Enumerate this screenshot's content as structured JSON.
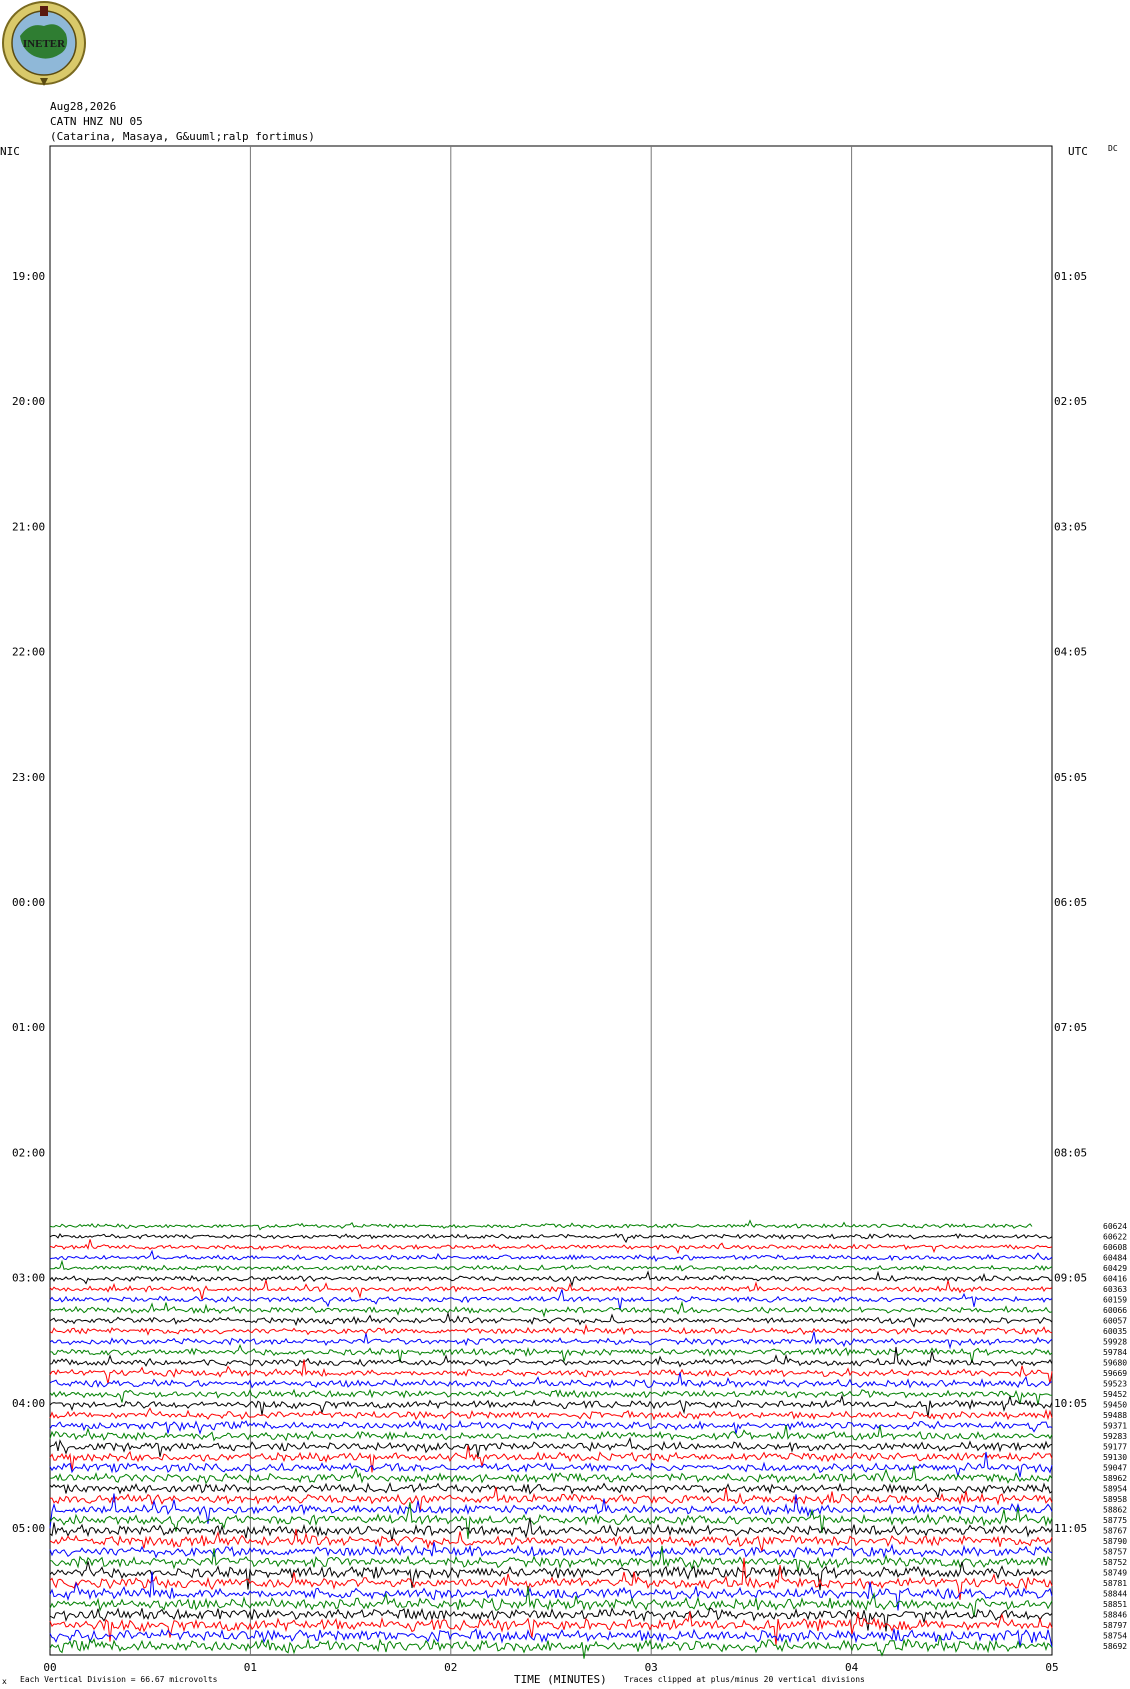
{
  "header": {
    "date": "Aug28,2026",
    "channel": "CATN HNZ NU 05",
    "location": "(Catarina, Masaya, G&uuml;ralp fortimus)",
    "left_zone": "NIC",
    "right_zone": "UTC",
    "dc_label": "DC"
  },
  "logo": {
    "text": "INETER"
  },
  "footer": {
    "scale": "Each Vertical Division =   66.67 microvolts",
    "xlabel": "TIME (MINUTES)",
    "clip_note": "Traces clipped at plus/minus 20 vertical divisions"
  },
  "chart_data": {
    "type": "line",
    "title": "CATN HNZ NU 05",
    "xlabel": "TIME (MINUTES)",
    "x_ticks": [
      "00",
      "01",
      "02",
      "03",
      "04",
      "05"
    ],
    "xlim": [
      0,
      5
    ],
    "left_time_labels": [
      "19:00",
      "20:00",
      "21:00",
      "22:00",
      "23:00",
      "00:00",
      "01:00",
      "02:00",
      "03:00",
      "04:00",
      "05:00"
    ],
    "right_time_labels": [
      "01:05",
      "02:05",
      "03:05",
      "04:05",
      "05:05",
      "06:05",
      "07:05",
      "08:05",
      "09:05",
      "10:05",
      "11:05"
    ],
    "trace_colors": [
      "#008000",
      "#000000",
      "#ff0000",
      "#0000ff"
    ],
    "trace_values": [
      "60624",
      "60622",
      "60608",
      "60484",
      "60429",
      "60416",
      "60363",
      "60159",
      "60066",
      "60057",
      "60035",
      "59928",
      "59784",
      "59680",
      "59669",
      "59523",
      "59452",
      "59450",
      "59488",
      "59371",
      "59283",
      "59177",
      "59130",
      "59047",
      "58962",
      "58954",
      "58958",
      "58862",
      "58775",
      "58767",
      "58790",
      "58757",
      "58752",
      "58749",
      "58781",
      "58844",
      "58851",
      "58846",
      "58797",
      "58754",
      "58692"
    ]
  }
}
